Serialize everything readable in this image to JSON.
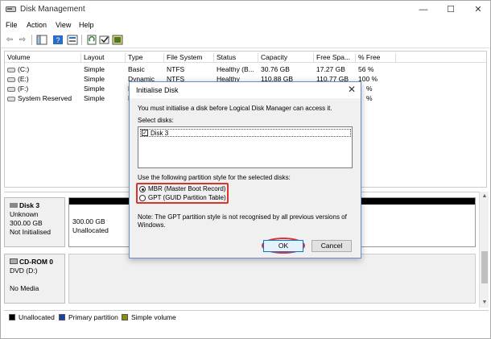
{
  "window": {
    "title": "Disk Management",
    "minimize": "—",
    "maximize": "☐",
    "close": "✕"
  },
  "menu": [
    "File",
    "Action",
    "View",
    "Help"
  ],
  "toolbar": {
    "back": "⇦",
    "forward": "⇨"
  },
  "volume_list": {
    "columns": [
      "Volume",
      "Layout",
      "Type",
      "File System",
      "Status",
      "Capacity",
      "Free Spa...",
      "% Free"
    ],
    "rows": [
      [
        "(C:)",
        "Simple",
        "Basic",
        "NTFS",
        "Healthy (B...",
        "30.76 GB",
        "17.27 GB",
        "56 %"
      ],
      [
        "(E:)",
        "Simple",
        "Dynamic",
        "NTFS",
        "Healthy",
        "110.88 GB",
        "110.77 GB",
        "100 %"
      ],
      [
        "(F:)",
        "Simple",
        "D",
        "",
        "",
        "",
        "",
        "%"
      ],
      [
        "System Reserved",
        "Simple",
        "B",
        "",
        "",
        "",
        "",
        "%"
      ]
    ]
  },
  "disks": [
    {
      "name": "Disk 3",
      "type": "Unknown",
      "size": "300.00 GB",
      "status": "Not Initialised",
      "partition_size": "300.00 GB",
      "partition_state": "Unallocated"
    },
    {
      "name": "CD-ROM 0",
      "type": "DVD (D:)",
      "status": "No Media"
    }
  ],
  "legend": [
    {
      "label": "Unallocated",
      "color": "#000000"
    },
    {
      "label": "Primary partition",
      "color": "#1c3fa8"
    },
    {
      "label": "Simple volume",
      "color": "#8a8a12"
    }
  ],
  "dialog": {
    "title": "Initialise Disk",
    "close": "✕",
    "intro": "You must initialise a disk before Logical Disk Manager can access it.",
    "select_label": "Select disks:",
    "disk_item": "Disk 3",
    "style_label": "Use the following partition style for the selected disks:",
    "options": [
      {
        "label": "MBR (Master Boot Record)",
        "selected": true
      },
      {
        "label": "GPT (GUID Partition Table)",
        "selected": false
      }
    ],
    "note_line1": "Note: The GPT partition style is not recognised by all previous versions of",
    "note_line2": "Windows.",
    "ok": "OK",
    "cancel": "Cancel"
  },
  "colors": {
    "highlight_ring": "#d9342b",
    "accent": "#0078d7"
  }
}
